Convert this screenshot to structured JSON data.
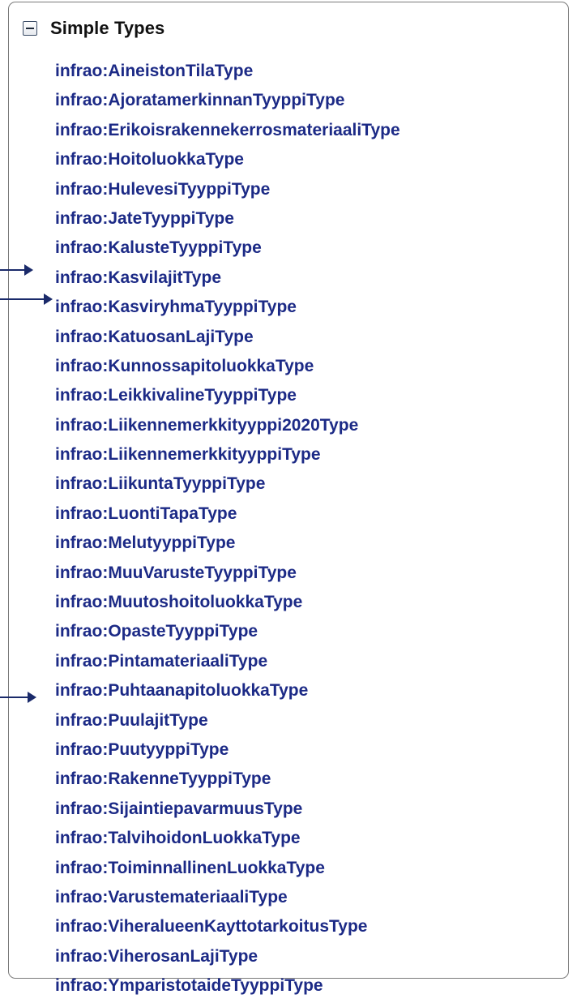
{
  "section": {
    "title": "Simple Types",
    "toggle_state": "expanded"
  },
  "colors": {
    "link": "#1c2a86",
    "arrow": "#1a2a6a",
    "border": "#7a7a7a"
  },
  "types": [
    "infrao:AineistonTilaType",
    "infrao:AjoratamerkinnanTyyppiType",
    "infrao:ErikoisrakennekerrosmateriaaliType",
    "infrao:HoitoluokkaType",
    "infrao:HulevesiTyyppiType",
    "infrao:JateTyyppiType",
    "infrao:KalusteTyyppiType",
    "infrao:KasvilajitType",
    "infrao:KasviryhmaTyyppiType",
    "infrao:KatuosanLajiType",
    "infrao:KunnossapitoluokkaType",
    "infrao:LeikkivalineTyyppiType",
    "infrao:Liikennemerkkityyppi2020Type",
    "infrao:LiikennemerkkityyppiType",
    "infrao:LiikuntaTyyppiType",
    "infrao:LuontiTapaType",
    "infrao:MelutyyppiType",
    "infrao:MuuVarusteTyyppiType",
    "infrao:MuutoshoitoluokkaType",
    "infrao:OpasteTyyppiType",
    "infrao:PintamateriaaliType",
    "infrao:PuhtaanapitoluokkaType",
    "infrao:PuulajitType",
    "infrao:PuutyyppiType",
    "infrao:RakenneTyyppiType",
    "infrao:SijaintiepavarmuusType",
    "infrao:TalvihoidonLuokkaType",
    "infrao:ToiminnallinenLuokkaType",
    "infrao:VarustemateriaaliType",
    "infrao:ViheralueenKayttotarkoitusType",
    "infrao:ViherosanLajiType",
    "infrao:YmparistotaideTyyppiType"
  ]
}
